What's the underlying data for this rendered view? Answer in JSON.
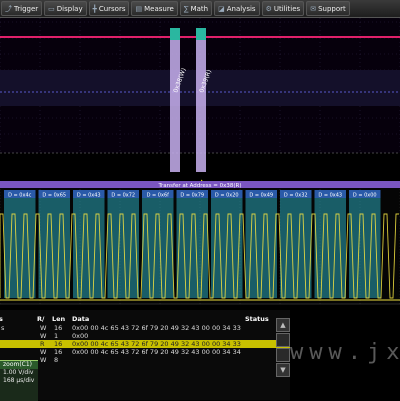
{
  "menubar": {
    "items": [
      {
        "label": "Trigger",
        "icon": "trigger-icon"
      },
      {
        "label": "Display",
        "icon": "display-icon"
      },
      {
        "label": "Cursors",
        "icon": "cursors-icon"
      },
      {
        "label": "Measure",
        "icon": "measure-icon"
      },
      {
        "label": "Math",
        "icon": "math-icon"
      },
      {
        "label": "Analysis",
        "icon": "analysis-icon"
      },
      {
        "label": "Utilities",
        "icon": "utilities-icon"
      },
      {
        "label": "Support",
        "icon": "support-icon"
      }
    ]
  },
  "scope": {
    "zoom_labels": [
      "0x38(W)",
      "0x39(R)"
    ],
    "transfer_banner": "Transfer at Address = 0x38(R)",
    "decode_labels": [
      "D = 0x4c",
      "D = 0x65",
      "D = 0x43",
      "D = 0x72",
      "D = 0x6f",
      "D = 0x79",
      "D = 0x20",
      "D = 0x49",
      "D = 0x32",
      "D = 0x43",
      "D = 0x00"
    ],
    "colors": {
      "channel_magenta": "#e0206a",
      "decode_teal": "#2aa6b8",
      "clock_yellow": "#f0e040",
      "highlight": "#c8c000"
    }
  },
  "table": {
    "headers": {
      "index": "#",
      "rw": "R/\nW",
      "len": "Len",
      "data": "Data",
      "status": "Status"
    },
    "header_rw": "R/",
    "header_len": "Len",
    "header_data": "Data",
    "header_status": "Status",
    "header_extra": "s",
    "rows": [
      {
        "idx": "s",
        "rw": "W",
        "len": "16",
        "data": "0x00 00 4c 65 43 72 6f 79 20 49 32 43 00 00 34 33",
        "selected": false
      },
      {
        "idx": "",
        "rw": "W",
        "len": "1",
        "data": "0x00",
        "selected": false
      },
      {
        "idx": "",
        "rw": "R",
        "len": "16",
        "data": "0x00 00 4c 65 43 72 6f 79 20 49 32 43 00 00 34 33",
        "selected": true
      },
      {
        "idx": "",
        "rw": "W",
        "len": "16",
        "data": "0x00 00 4c 65 43 72 6f 79 20 49 32 43 00 00 34 34",
        "selected": false
      },
      {
        "idx": "",
        "rw": "W",
        "len": "8",
        "data": "",
        "selected": false
      }
    ]
  },
  "side_panel": {
    "zoom": "zoom(C1)",
    "vdiv": "1.00 V/div",
    "tdiv": "168 µs/div"
  },
  "scroll": {
    "up": "▲",
    "down": "▼"
  },
  "watermark": "www.jxw"
}
